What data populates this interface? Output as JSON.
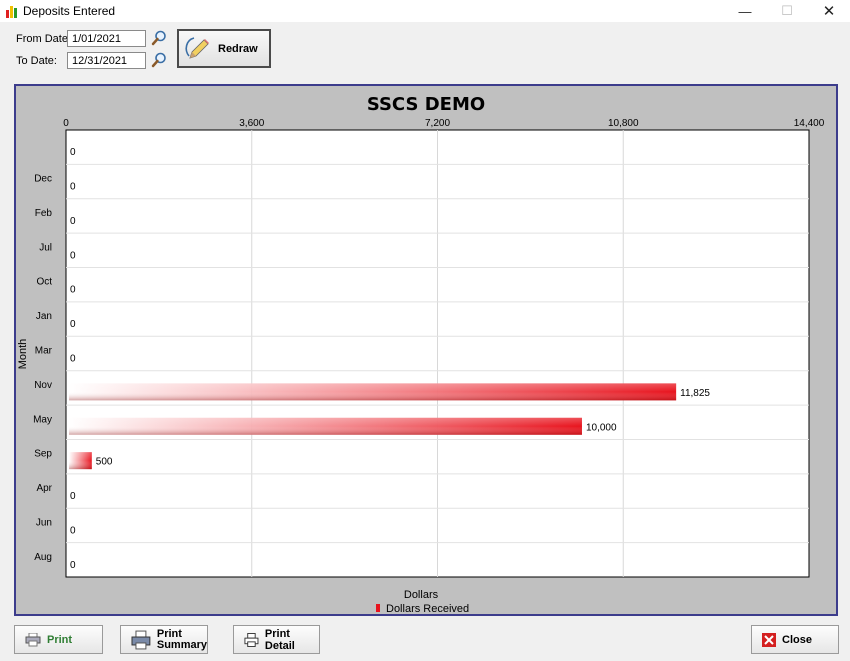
{
  "window": {
    "title": "Deposits Entered",
    "min_glyph": "—",
    "max_glyph": "☐",
    "close_glyph": "✕"
  },
  "filters": {
    "from_label": "From Date:",
    "from_value": "1/01/2021",
    "to_label": "To Date:",
    "to_value": "12/31/2021",
    "redraw_label": "Redraw"
  },
  "footer": {
    "print_label": "Print",
    "print_summary_line1": "Print",
    "print_summary_line2": "Summary",
    "print_detail_label": "Print Detail",
    "close_label": "Close"
  },
  "colors": {
    "bar": "#e8141e",
    "frame_border": "#3c3c8c",
    "chart_bg": "#c0c0c0"
  },
  "chart_data": {
    "type": "bar",
    "orientation": "horizontal",
    "title": "SSCS DEMO",
    "xlabel": "Dollars",
    "ylabel": "Month",
    "xlim": [
      0,
      14400
    ],
    "xticks": [
      "0",
      "3,600",
      "7,200",
      "10,800",
      "14,400"
    ],
    "xtick_values": [
      0,
      3600,
      7200,
      10800,
      14400
    ],
    "grid": true,
    "legend_position": "bottom-center",
    "categories": [
      "",
      "Dec",
      "Feb",
      "Jul",
      "Oct",
      "Jan",
      "Mar",
      "Nov",
      "May",
      "Sep",
      "Apr",
      "Jun",
      "Aug"
    ],
    "series": [
      {
        "name": "Dollars Received",
        "values": [
          0,
          0,
          0,
          0,
          0,
          0,
          0,
          11825,
          10000,
          500,
          0,
          0,
          0
        ],
        "labels": [
          "0",
          "0",
          "0",
          "0",
          "0",
          "0",
          "0",
          "11,825",
          "10,000",
          "500",
          "0",
          "0",
          "0"
        ]
      }
    ]
  }
}
